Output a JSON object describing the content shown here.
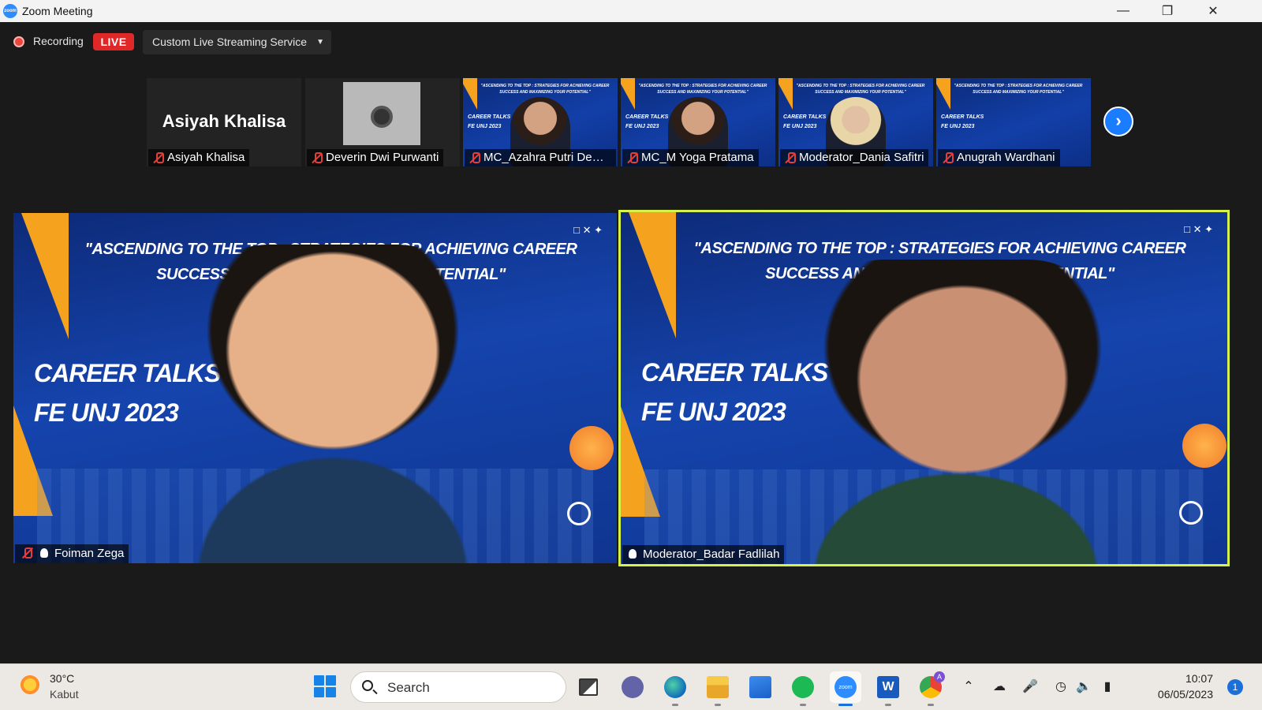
{
  "window": {
    "title": "Zoom Meeting",
    "logo_text": "zoom"
  },
  "recording": {
    "label": "Recording",
    "live_badge": "LIVE",
    "stream_service": "Custom Live Streaming Service"
  },
  "thumbnails": [
    {
      "name": "Asiyah Khalisa",
      "big_name": "Asiyah Khalisa",
      "type": "name-card",
      "muted": true
    },
    {
      "name": "Deverin Dwi Purwanti",
      "type": "photo",
      "muted": true
    },
    {
      "name": "MC_Azahra Putri Dewi...",
      "type": "video",
      "muted": true
    },
    {
      "name": "MC_M Yoga Pratama",
      "type": "video",
      "muted": true
    },
    {
      "name": "Moderator_Dania Safitri",
      "type": "video",
      "muted": true
    },
    {
      "name": "Anugrah Wardhani",
      "type": "slide",
      "muted": true
    }
  ],
  "slide": {
    "headline": "\"ASCENDING TO THE TOP : STRATEGIES FOR ACHIEVING CAREER SUCCESS AND MAXIMIZING YOUR POTENTIAL\"",
    "event_line1": "CAREER TALKS",
    "event_line2": "FE UNJ 2023"
  },
  "main_tiles": [
    {
      "name": "Foiman Zega",
      "muted": true,
      "pinned": true,
      "active_speaker": false
    },
    {
      "name": "Moderator_Badar Fadlilah",
      "muted": false,
      "pinned": true,
      "active_speaker": true
    }
  ],
  "taskbar": {
    "weather_temp": "30°C",
    "weather_desc": "Kabut",
    "search_placeholder": "Search",
    "time": "10:07",
    "date": "06/05/2023",
    "notification_count": "1",
    "chrome_badge": "A"
  },
  "colors": {
    "live": "#e02828",
    "active_border": "#d6f24a",
    "accent": "#1a7cff",
    "slide_blue": "#1544ad",
    "slide_orange": "#f5a21e"
  }
}
